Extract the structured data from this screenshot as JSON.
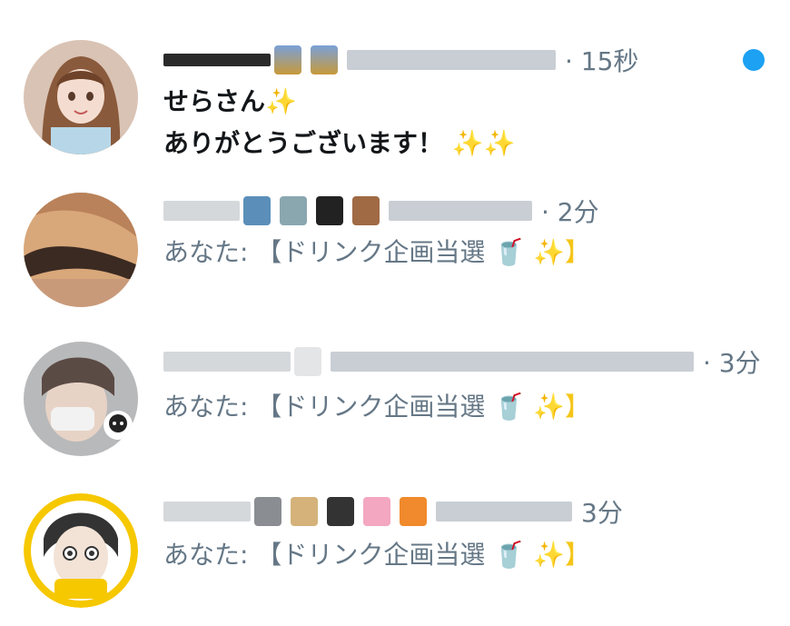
{
  "conversations": [
    {
      "time": "· 15秒",
      "unread": true,
      "lines": [
        "せらさん",
        "ありがとうございます！"
      ],
      "sparkle_1": "✨",
      "sparkle_2": "✨✨",
      "avatar_icon": "anime-girl-avatar"
    },
    {
      "time": "· 2分",
      "unread": false,
      "preview": "あなた: 【ドリンク企画当選",
      "cup": "🥤",
      "sparkle": "✨】",
      "avatar_icon": "hair-photo-avatar"
    },
    {
      "time": "· 3分",
      "unread": false,
      "preview": "あなた: 【ドリンク企画当選",
      "cup": "🥤",
      "sparkle": "✨】",
      "avatar_icon": "selfie-photo-avatar"
    },
    {
      "time": "3分",
      "unread": false,
      "preview": "あなた: 【ドリンク企画当選",
      "cup": "🥤",
      "sparkle": "✨】",
      "avatar_icon": "cartoon-face-avatar"
    }
  ],
  "colors": {
    "accent": "#1da1f2",
    "secondary_text": "#657786",
    "primary_text": "#14171a"
  }
}
